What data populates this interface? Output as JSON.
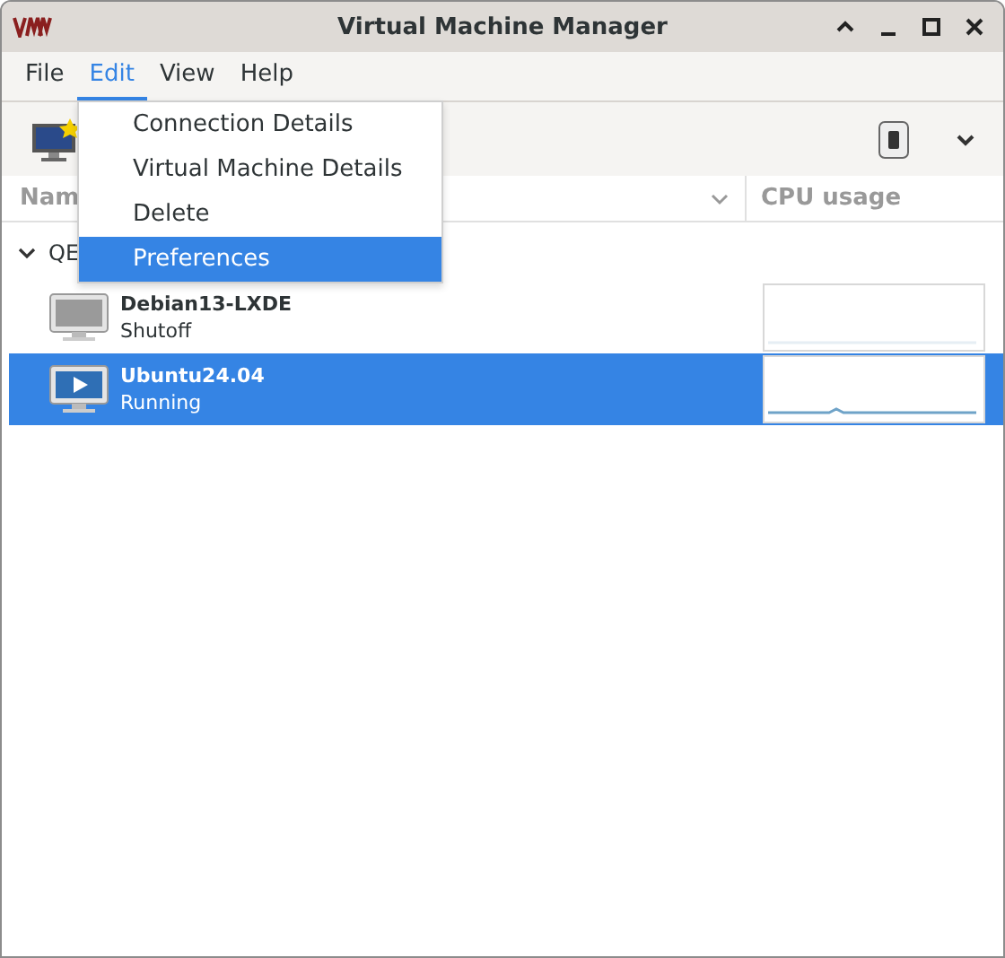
{
  "window": {
    "title": "Virtual Machine Manager"
  },
  "menubar": [
    {
      "label": "File",
      "selected": false
    },
    {
      "label": "Edit",
      "selected": true
    },
    {
      "label": "View",
      "selected": false
    },
    {
      "label": "Help",
      "selected": false
    }
  ],
  "menu": {
    "items": [
      {
        "label": "Connection Details",
        "selected": false
      },
      {
        "label": "Virtual Machine Details",
        "selected": false
      },
      {
        "label": "Delete",
        "selected": false
      },
      {
        "label": "Preferences",
        "selected": true
      }
    ]
  },
  "table": {
    "columns": [
      "Nam",
      "CPU usage"
    ],
    "group": {
      "label": "QE",
      "expanded": true
    },
    "rows": [
      {
        "name": "Debian13-LXDE",
        "status": "Shutoff",
        "running": false,
        "selected": false
      },
      {
        "name": "Ubuntu24.04",
        "status": "Running",
        "running": true,
        "selected": true
      }
    ]
  }
}
